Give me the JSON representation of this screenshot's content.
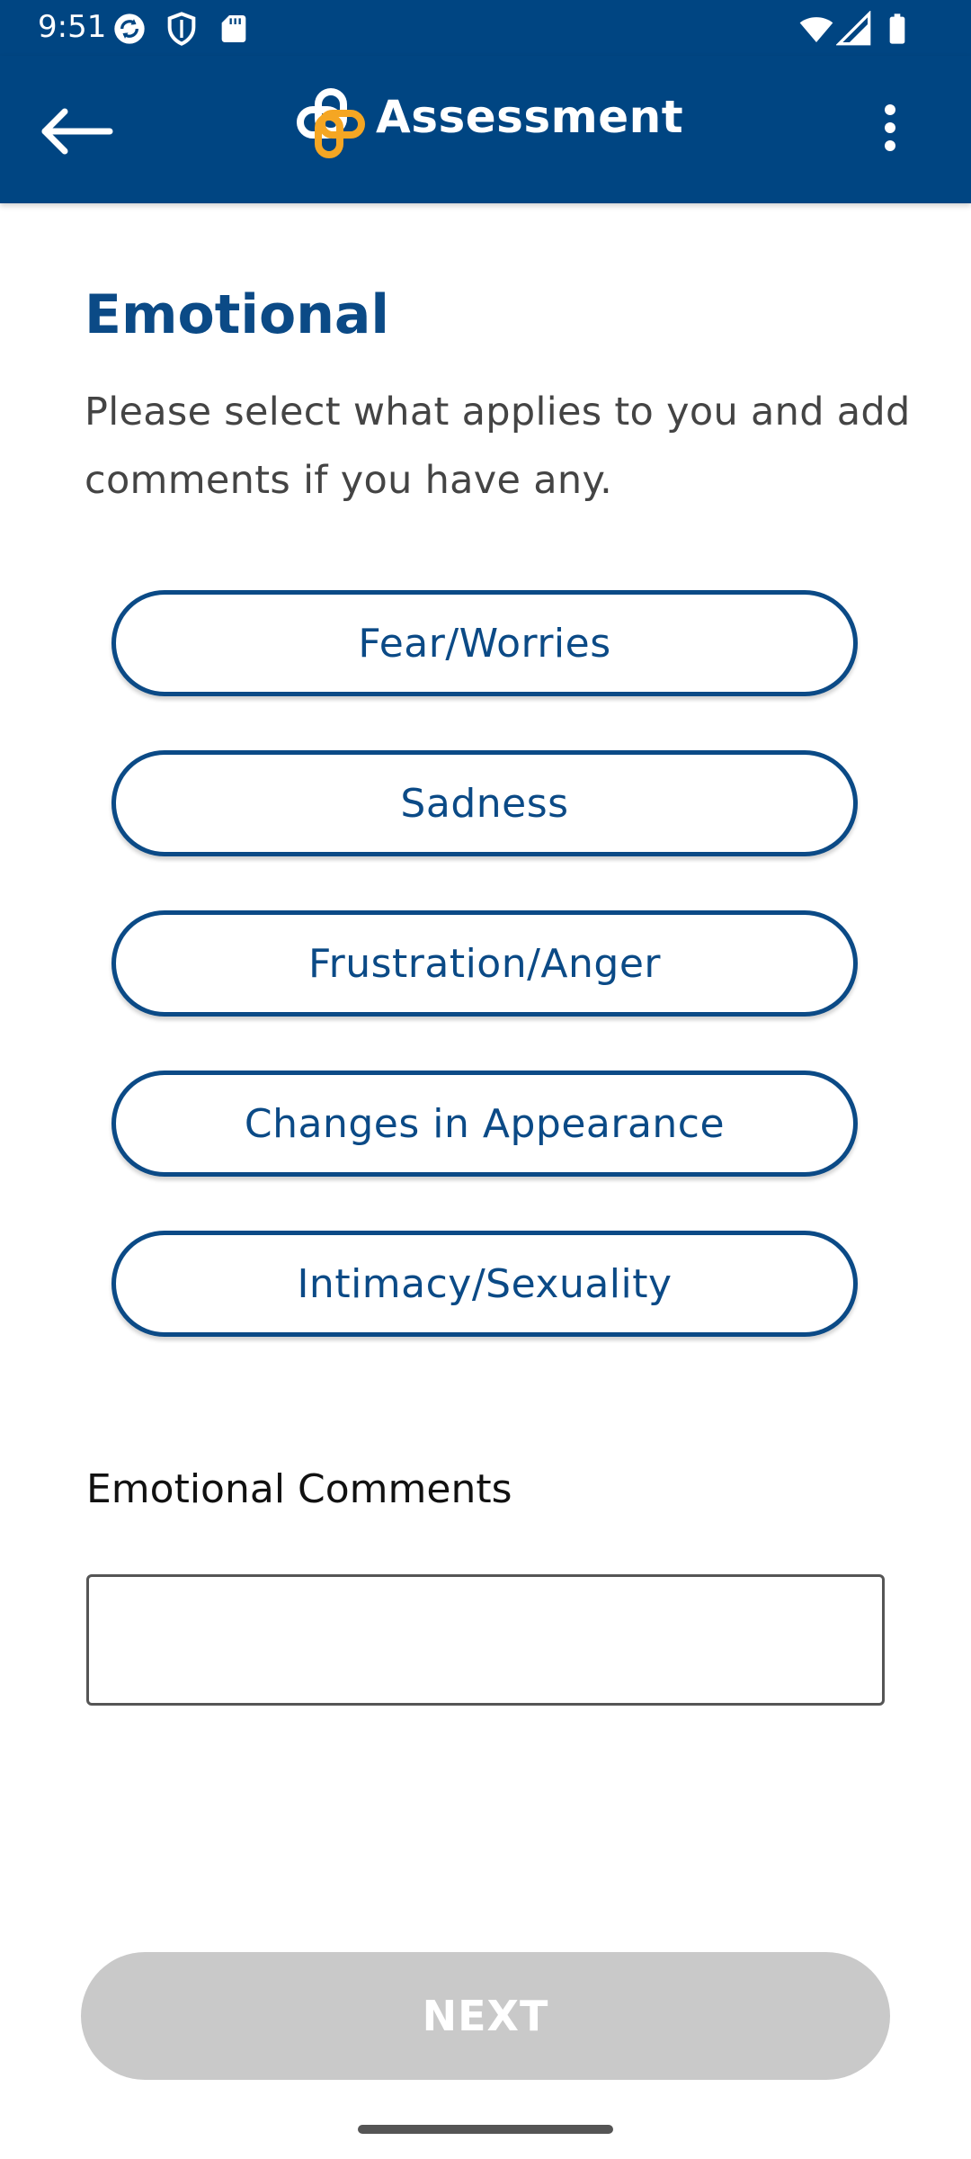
{
  "status_bar": {
    "time": "9:51",
    "left_icons": [
      "sync-icon",
      "shield-icon",
      "sd-card-icon"
    ],
    "right_icons": [
      "wifi-icon",
      "signal-icon",
      "battery-icon"
    ],
    "background": "#004582"
  },
  "app_bar": {
    "title": "Assessment",
    "back_icon": "arrow-left-icon",
    "logo_icon": "app-logo-icon",
    "menu_icon": "more-vert-icon",
    "background": "#004582",
    "logo_colors": {
      "ring": "#ffffff",
      "accent": "#f5a623"
    }
  },
  "section": {
    "title": "Emotional",
    "instructions": "Please select what applies to you and add comments if you have any."
  },
  "options": [
    {
      "label": "Fear/Worries",
      "selected": false
    },
    {
      "label": "Sadness",
      "selected": false
    },
    {
      "label": "Frustration/Anger",
      "selected": false
    },
    {
      "label": "Changes in Appearance",
      "selected": false
    },
    {
      "label": "Intimacy/Sexuality",
      "selected": false
    }
  ],
  "comments": {
    "label": "Emotional Comments",
    "value": "",
    "placeholder": ""
  },
  "footer": {
    "next_label": "NEXT",
    "next_enabled": false
  },
  "colors": {
    "primary": "#0b4a86",
    "disabled_button": "#c9c9c9",
    "text_muted": "#444444"
  }
}
